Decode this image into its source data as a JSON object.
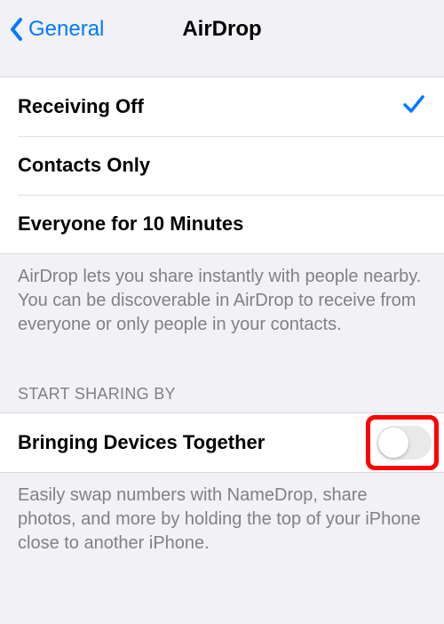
{
  "nav": {
    "back_label": "General",
    "title": "AirDrop"
  },
  "discoverability": {
    "options": [
      {
        "label": "Receiving Off",
        "selected": true
      },
      {
        "label": "Contacts Only",
        "selected": false
      },
      {
        "label": "Everyone for 10 Minutes",
        "selected": false
      }
    ],
    "footer": "AirDrop lets you share instantly with people nearby. You can be discoverable in AirDrop to receive from everyone or only people in your contacts."
  },
  "sharing": {
    "header": "START SHARING BY",
    "row_label": "Bringing Devices Together",
    "toggle_on": false,
    "footer": "Easily swap numbers with NameDrop, share photos, and more by holding the top of your iPhone close to another iPhone."
  },
  "colors": {
    "accent": "#007aff",
    "highlight": "#ff0000"
  }
}
